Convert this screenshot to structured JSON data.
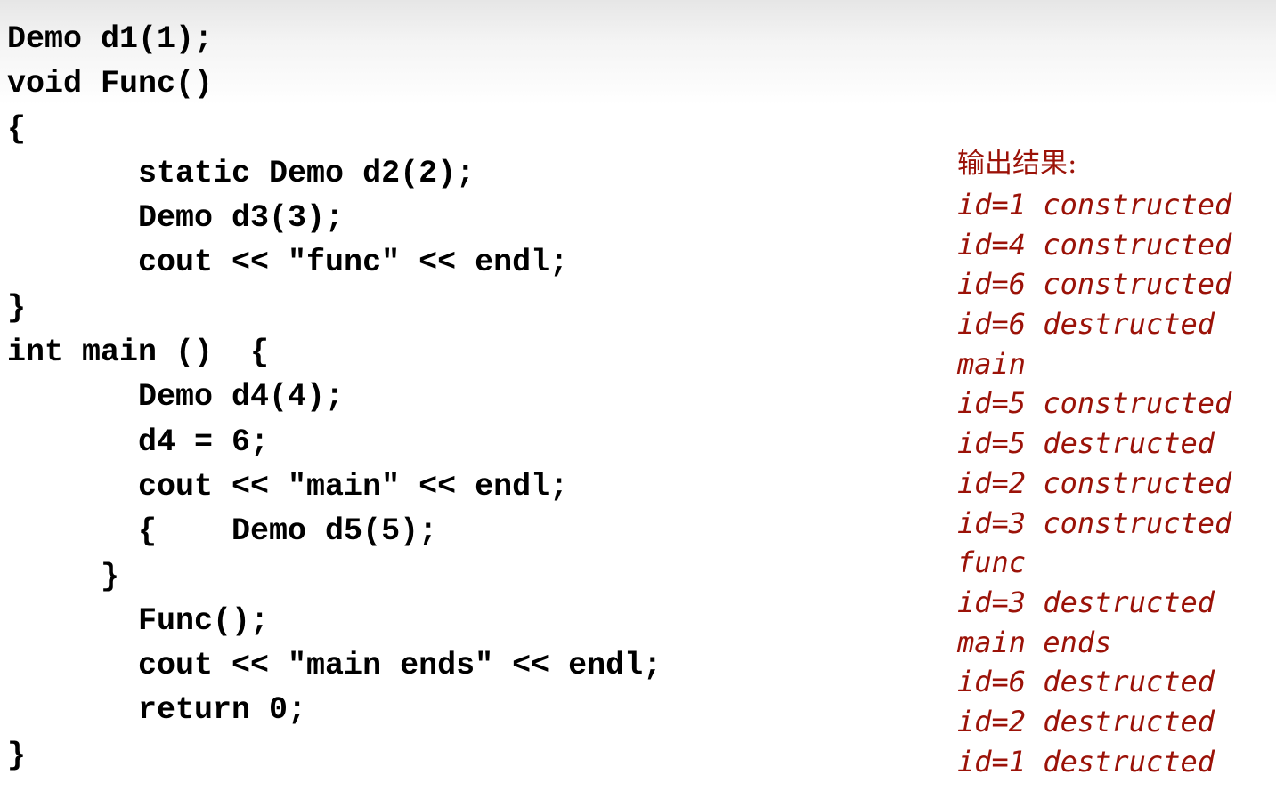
{
  "code": {
    "lines": [
      "Demo d1(1);",
      "void Func()",
      "{",
      "       static Demo d2(2);",
      "       Demo d3(3);",
      "       cout << \"func\" << endl;",
      "}",
      "int main ()  {",
      "       Demo d4(4);",
      "       d4 = 6;",
      "       cout << \"main\" << endl;",
      "       {    Demo d5(5);",
      "     }",
      "       Func();",
      "       cout << \"main ends\" << endl;",
      "       return 0;",
      "}"
    ]
  },
  "output": {
    "title": "输出结果:",
    "lines": [
      "id=1 constructed",
      "id=4 constructed",
      "id=6 constructed",
      "id=6 destructed",
      "main",
      "id=5 constructed",
      "id=5 destructed",
      "id=2 constructed",
      "id=3 constructed",
      "func",
      "id=3 destructed",
      "main ends",
      "id=6 destructed",
      "id=2 destructed",
      "id=1 destructed"
    ]
  },
  "colors": {
    "code_text": "#000000",
    "output_text": "#9b1208",
    "background": "#ffffff"
  }
}
